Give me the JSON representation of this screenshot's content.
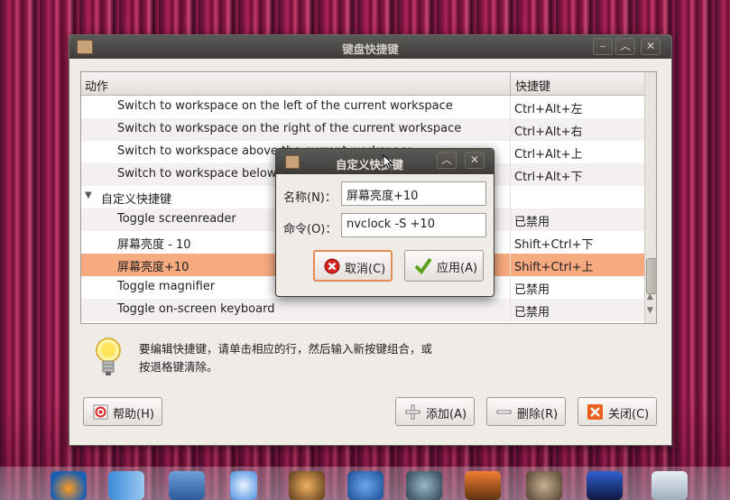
{
  "window": {
    "title": "键盘快捷键"
  },
  "tree": {
    "col_action": "动作",
    "col_shortcut": "快捷键",
    "rows": [
      {
        "action": "Switch to workspace on the left of the current workspace",
        "shortcut": "Ctrl+Alt+左"
      },
      {
        "action": "Switch to workspace on the right of the current workspace",
        "shortcut": "Ctrl+Alt+右"
      },
      {
        "action": "Switch to workspace above the current workspace",
        "shortcut": "Ctrl+Alt+上"
      },
      {
        "action": "Switch to workspace below",
        "shortcut": "Ctrl+Alt+下"
      },
      {
        "action": "自定义快捷键",
        "shortcut": ""
      },
      {
        "action": "Toggle screenreader",
        "shortcut": "已禁用"
      },
      {
        "action": "屏幕亮度 - 10",
        "shortcut": "Shift+Ctrl+下"
      },
      {
        "action": "屏幕亮度+10",
        "shortcut": "Shift+Ctrl+上"
      },
      {
        "action": "Toggle magnifier",
        "shortcut": "已禁用"
      },
      {
        "action": "Toggle on-screen keyboard",
        "shortcut": "已禁用"
      }
    ]
  },
  "info_text": "要编辑快捷键，请单击相应的行，然后输入新按键组合，或按退格键清除。",
  "buttons": {
    "help": "帮助(H)",
    "add": "添加(A)",
    "delete": "删除(R)",
    "close": "关闭(C)"
  },
  "dialog": {
    "title": "自定义快捷键",
    "name_label": "名称(N)：",
    "name_value": "屏幕亮度+10",
    "command_label": "命令(O)：",
    "command_value": "nvclock -S +10",
    "cancel": "取消(C)",
    "apply": "应用(A)"
  },
  "colors": {
    "selection": "#f7a97f",
    "accent": "#e88a54"
  },
  "dock_icons": [
    "firefox-icon",
    "finder-icon",
    "mail-icon",
    "itunes-icon",
    "gimp-icon",
    "facetime-icon",
    "time-machine-icon",
    "photo-icon",
    "gimp-wilber-icon",
    "video-icon",
    "printer-icon"
  ]
}
